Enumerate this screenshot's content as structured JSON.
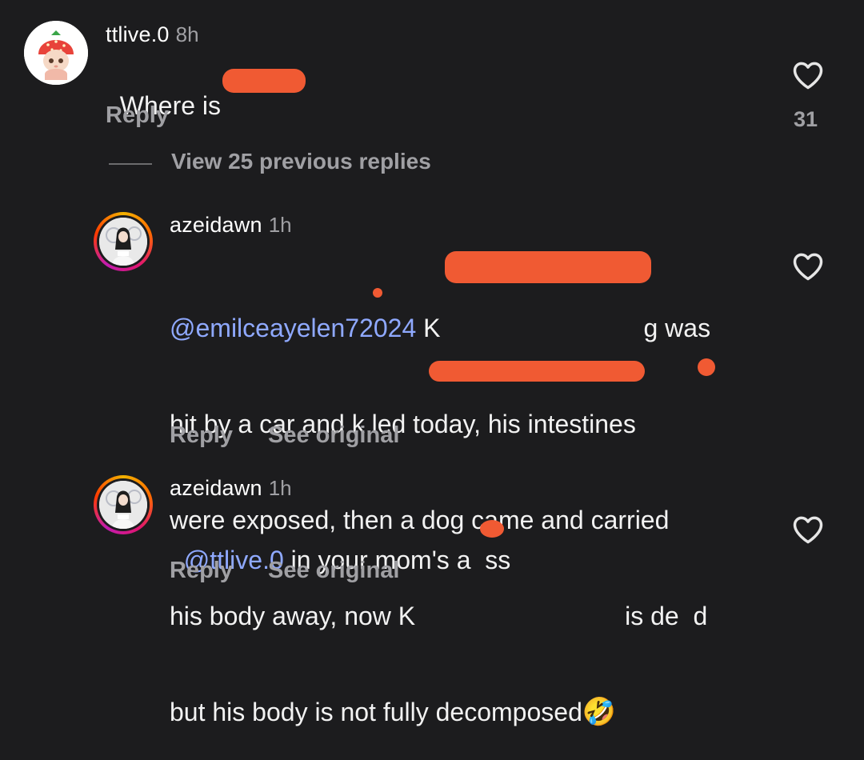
{
  "top_comment": {
    "username": "ttlive.0",
    "time": "8h",
    "text_prefix": "Where is ",
    "text_suffix": "",
    "reply_label": "Reply",
    "likes": "31"
  },
  "thread": {
    "view_previous_label": "View 25 previous replies"
  },
  "replies": [
    {
      "username": "azeidawn",
      "time": "1h",
      "mention": "@emilceayelen72024",
      "line1_after_mention": " K",
      "line1_end": "g was",
      "line2": "hit by a car and k led today, his intestines",
      "line3": "were exposed, then a dog came and carried",
      "line4": "his body away, now K",
      "line4_end": "is de  d",
      "line5": "but his body is not fully decomposed",
      "emoji": "🤣",
      "reply_label": "Reply",
      "see_original_label": "See original"
    },
    {
      "username": "azeidawn",
      "time": "1h",
      "mention": "@ttlive.0",
      "text": " in your mom's a  ss",
      "reply_label": "Reply",
      "see_original_label": "See original"
    }
  ],
  "icons": {
    "like": "heart-outline-icon",
    "avatar_top": "strawberry-hat-figurine-avatar",
    "avatar_reply": "profile-photo-avatar-with-story-ring"
  },
  "colors": {
    "background": "#1c1c1e",
    "text": "#f2f2f2",
    "muted": "#a0a0a4",
    "mention": "#8fa9ff",
    "redaction": "#f05a33"
  }
}
